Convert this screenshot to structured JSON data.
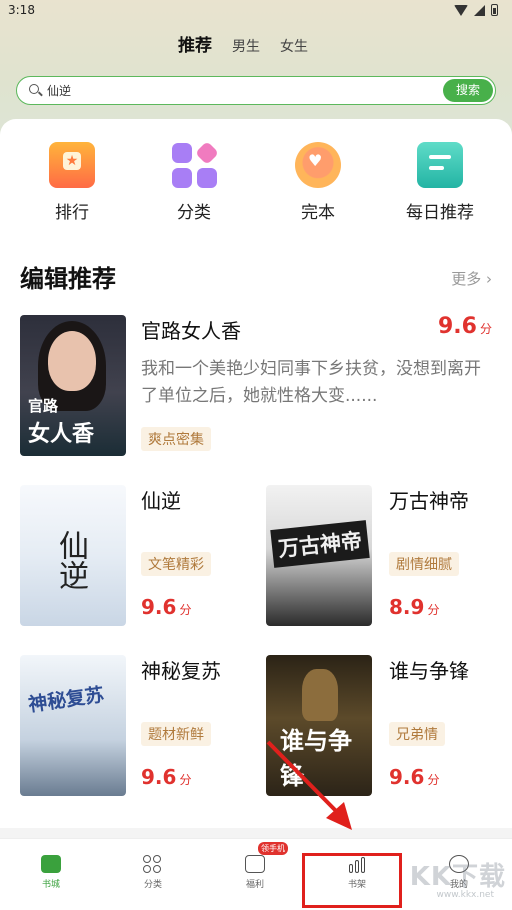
{
  "status": {
    "time": "3:18"
  },
  "tabs": [
    {
      "label": "推荐",
      "active": true
    },
    {
      "label": "男生",
      "active": false
    },
    {
      "label": "女生",
      "active": false
    }
  ],
  "search": {
    "value": "仙逆",
    "button": "搜索"
  },
  "categories": [
    {
      "label": "排行",
      "icon": "ranking-icon"
    },
    {
      "label": "分类",
      "icon": "category-grid-icon"
    },
    {
      "label": "完本",
      "icon": "completed-badge-icon"
    },
    {
      "label": "每日推荐",
      "icon": "daily-recommend-icon"
    }
  ],
  "section": {
    "title": "编辑推荐",
    "more": "更多 ›"
  },
  "featured": {
    "title": "官路女人香",
    "score": "9.6",
    "unit": "分",
    "desc": "我和一个美艳少妇同事下乡扶贫，没想到离开了单位之后，她就性格大变......",
    "tag": "爽点密集",
    "cover_text_a": "官路",
    "cover_text_b": "女人香"
  },
  "books": [
    {
      "title": "仙逆",
      "tag": "文笔精彩",
      "score": "9.6",
      "unit": "分",
      "cover_text": "仙逆"
    },
    {
      "title": "万古神帝",
      "tag": "剧情细腻",
      "score": "8.9",
      "unit": "分",
      "cover_text": "万古神帝"
    },
    {
      "title": "神秘复苏",
      "tag": "题材新鲜",
      "score": "9.6",
      "unit": "分",
      "cover_text": "神秘复苏"
    },
    {
      "title": "谁与争锋",
      "tag": "兄弟情",
      "score": "9.6",
      "unit": "分",
      "cover_text": "谁与争锋"
    }
  ],
  "nav": [
    {
      "label": "书城",
      "active": true
    },
    {
      "label": "分类",
      "active": false
    },
    {
      "label": "福利",
      "active": false,
      "badge": "领手机"
    },
    {
      "label": "书架",
      "active": false
    },
    {
      "label": "我的",
      "active": false
    }
  ],
  "watermark": {
    "main": "KK下载",
    "sub": "www.kkx.net"
  },
  "colors": {
    "accent": "#48b04a",
    "score": "#e0322e",
    "highlight": "#e0201c"
  }
}
